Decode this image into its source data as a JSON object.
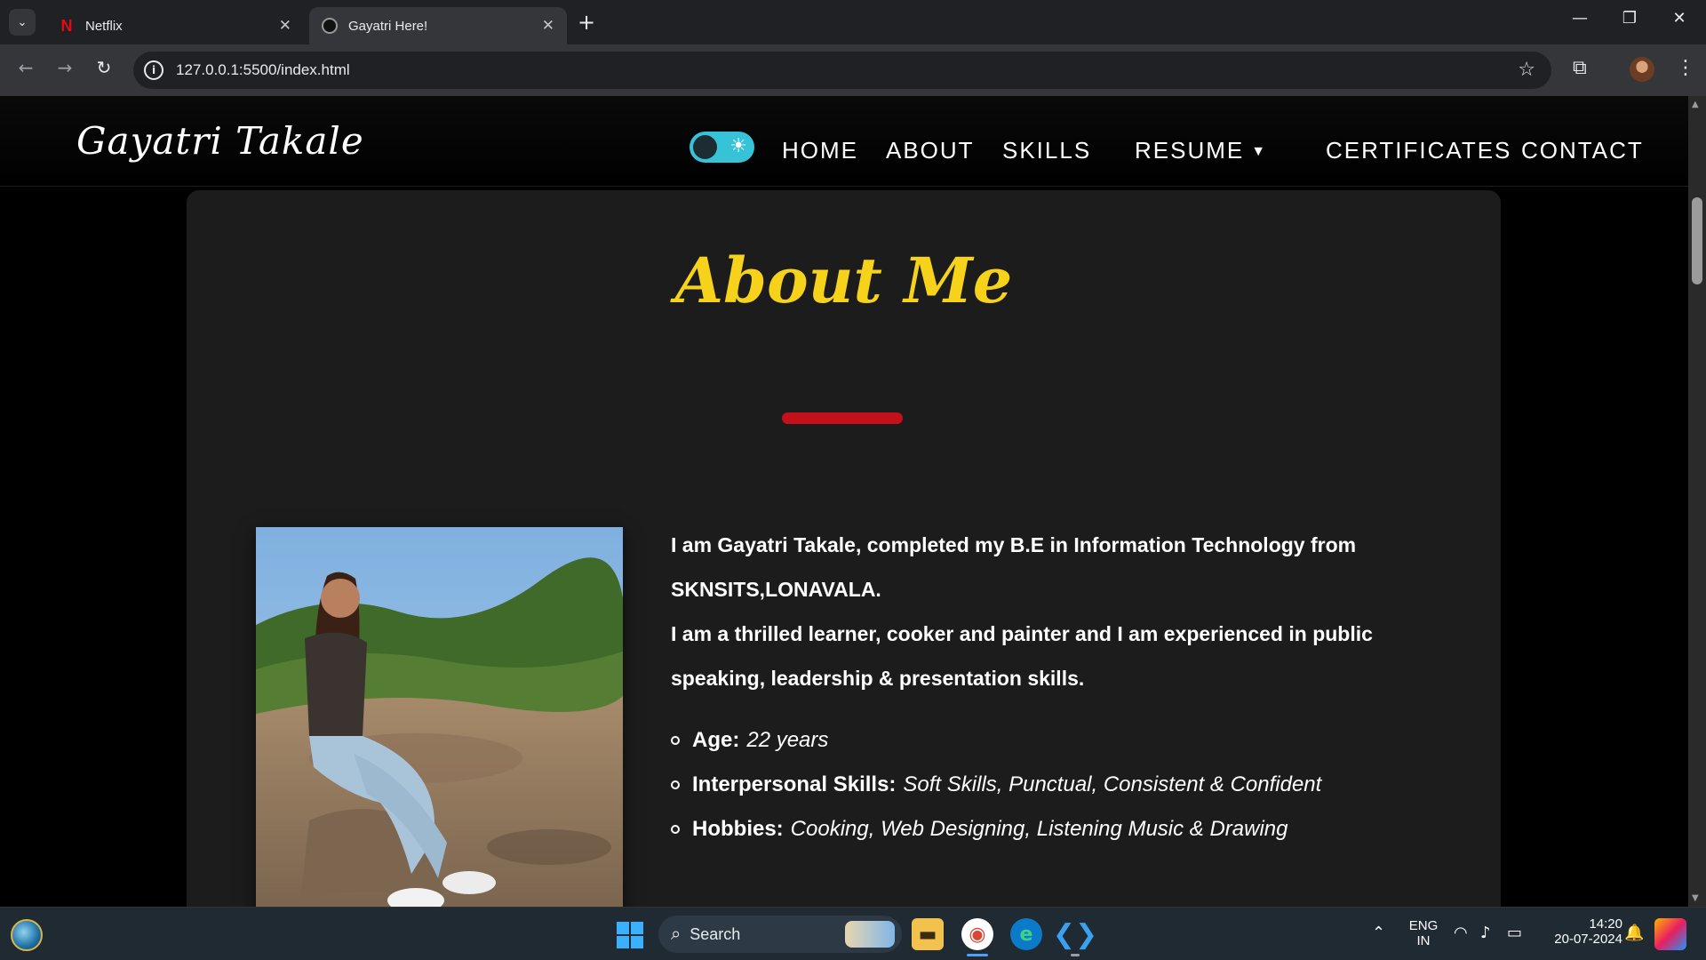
{
  "browser": {
    "tabs": [
      {
        "title": "Netflix",
        "favicon": "netflix-icon"
      },
      {
        "title": "Gayatri Here!",
        "favicon": "github-icon"
      }
    ],
    "url": "127.0.0.1:5500/index.html",
    "new_tab_symbol": "+",
    "close_symbol": "✕"
  },
  "site": {
    "logo": "Gayatri Takale",
    "nav": [
      "HOME",
      "ABOUT",
      "SKILLS",
      "RESUME",
      "CERTIFICATES",
      "CONTACT"
    ],
    "theme_toggle": "dark",
    "accent_color": "#f6d31a",
    "underline_color": "#c4101a"
  },
  "about": {
    "title": "About Me",
    "paragraph1": "I am Gayatri Takale, completed my B.E in Information Technology from SKNSITS,LONAVALA.",
    "paragraph2": "I am a thrilled learner, cooker and painter and I am experienced in public speaking, leadership & presentation skills.",
    "details": [
      {
        "label": "Age:",
        "value": "22 years"
      },
      {
        "label": "Interpersonal Skills:",
        "value": "Soft Skills, Punctual, Consistent & Confident"
      },
      {
        "label": "Hobbies:",
        "value": "Cooking, Web Designing, Listening Music & Drawing"
      }
    ]
  },
  "taskbar": {
    "search_placeholder": "Search",
    "language": "ENG",
    "region": "IN",
    "time": "14:20",
    "date": "20-07-2024"
  }
}
